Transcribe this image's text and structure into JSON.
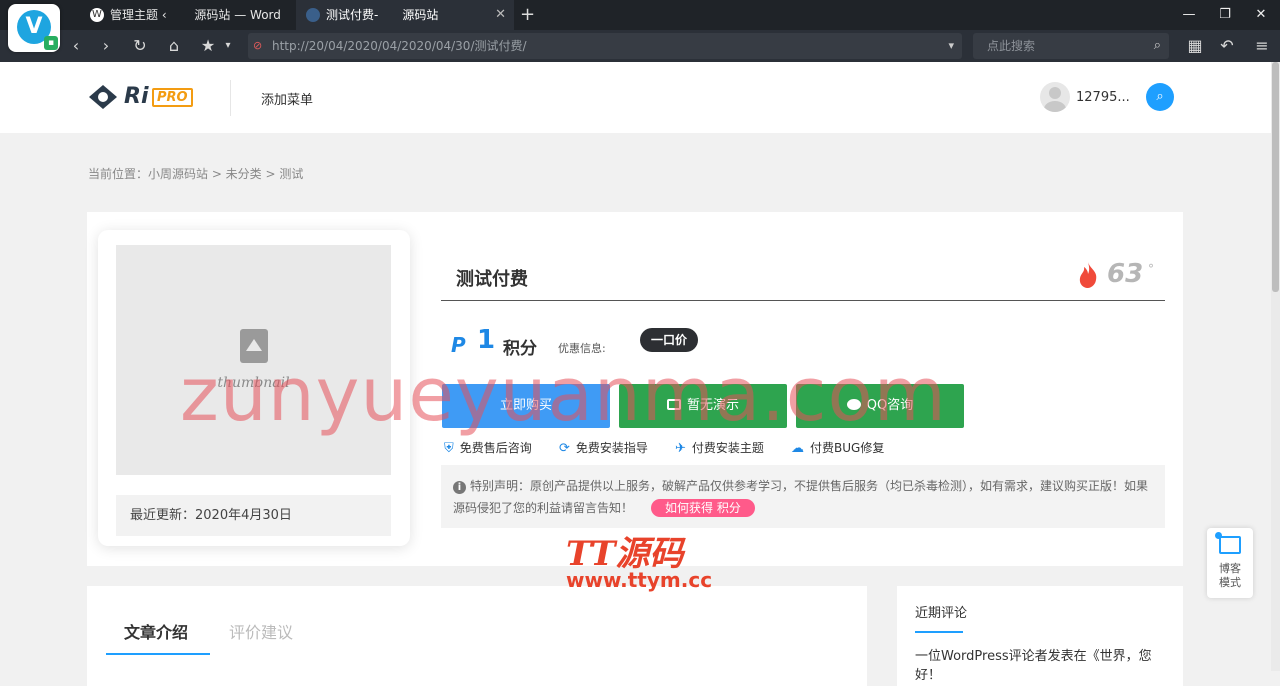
{
  "browser": {
    "tabs": [
      {
        "label": "管理主题 ‹ 　　源码站 — Word"
      },
      {
        "label": "测试付费-　　源码站"
      }
    ],
    "new_tab_glyph": "+",
    "url": "http://20/04/2020/04/2020/04/30/测试付费/",
    "search_placeholder": "点此搜索"
  },
  "site": {
    "logo_ri": "Ri",
    "logo_pro": "PRO",
    "nav_add_menu": "添加菜单",
    "username": "12795...",
    "breadcrumb": "当前位置：小周源码站 > 未分类 > 测试"
  },
  "product": {
    "thumbnail_label": "thumbnail",
    "updated": "最近更新：2020年4月30日",
    "title": "测试付费",
    "heat": "63",
    "heat_unit": "°",
    "price_symbol": "P",
    "price": "1",
    "price_unit": "积分",
    "promo_label": "优惠信息:",
    "promo_badge": "一口价",
    "buy_button": "立即购买",
    "demo_button": "暂无演示",
    "qq_button": "QQ咨询",
    "features": [
      "免费售后咨询",
      "免费安装指导",
      "付费安装主题",
      "付费BUG修复"
    ],
    "notice": "特别声明：原创产品提供以上服务，破解产品仅供参考学习，不提供售后服务（均已杀毒检测），如有需求，建议购买正版！如果源码侵犯了您的利益请留言告知！",
    "how_points": "如何获得 积分"
  },
  "article": {
    "tab_intro": "文章介绍",
    "tab_review": "评价建议"
  },
  "sidebar": {
    "recent_comments_title": "近期评论",
    "recent_comment": "一位WordPress评论者发表在《世界，您好！"
  },
  "blog_mode": {
    "label_line1": "博客",
    "label_line2": "模式"
  },
  "watermarks": {
    "big": "zunyueyuanma.com",
    "tt": "TT源码",
    "url": "www.ttym.cc"
  },
  "colors": {
    "accent": "#1e9fff",
    "buy": "#3f9bf5",
    "green": "#2ea44f",
    "pink": "#ff5a8a"
  }
}
